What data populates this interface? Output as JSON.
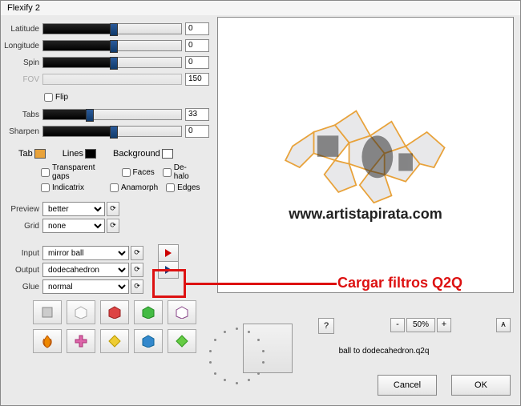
{
  "window": {
    "title": "Flexify 2"
  },
  "sliders": {
    "latitude": {
      "label": "Latitude",
      "value": "0",
      "fill": 50,
      "thumb": 50
    },
    "longitude": {
      "label": "Longitude",
      "value": "0",
      "fill": 50,
      "thumb": 50
    },
    "spin": {
      "label": "Spin",
      "value": "0",
      "fill": 50,
      "thumb": 50
    },
    "fov": {
      "label": "FOV",
      "value": "150",
      "fill": 0,
      "thumb": 0
    },
    "tabs": {
      "label": "Tabs",
      "value": "33",
      "fill": 33,
      "thumb": 33
    },
    "sharpen": {
      "label": "Sharpen",
      "value": "0",
      "fill": 50,
      "thumb": 50
    }
  },
  "checks": {
    "flip": "Flip",
    "transparent_gaps": "Transparent gaps",
    "faces": "Faces",
    "dehalo": "De-halo",
    "indicatrix": "Indicatrix",
    "anamorph": "Anamorph",
    "edges": "Edges"
  },
  "colors": {
    "tab_label": "Tab",
    "tab": "#e8a23a",
    "lines_label": "Lines",
    "lines": "#000000",
    "background_label": "Background",
    "background": "#ffffff"
  },
  "selects": {
    "preview_label": "Preview",
    "preview": "better",
    "grid_label": "Grid",
    "grid": "none",
    "input_label": "Input",
    "input": "mirror ball",
    "output_label": "Output",
    "output": "dodecahedron",
    "glue_label": "Glue",
    "glue": "normal"
  },
  "annotation": {
    "text": "Cargar filtros Q2Q"
  },
  "watermark": "www.artistapirata.com",
  "zoom": {
    "value": "50%",
    "minus": "-",
    "plus": "+",
    "a": "ᴀ"
  },
  "help": "?",
  "status": "ball to dodecahedron.q2q",
  "buttons": {
    "cancel": "Cancel",
    "ok": "OK"
  },
  "cycle": "⟳"
}
